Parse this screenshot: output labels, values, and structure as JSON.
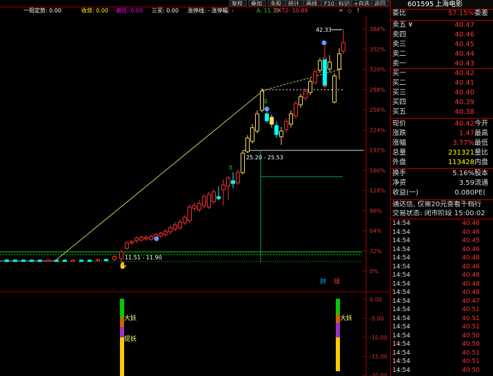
{
  "toolbar": {
    "buttons": [
      "复权",
      "叠加",
      "多股",
      "统计",
      "画线",
      "F10",
      "标记",
      "+自选",
      "返回"
    ]
  },
  "legend": {
    "items": [
      {
        "text": "一阳定势: 0.00",
        "color": "#ffffff"
      },
      {
        "text": "收敛: 0.00",
        "color": "#ffff00"
      },
      {
        "text": "偏低: 0.00",
        "color": "#ff00ff"
      },
      {
        "text": "三买: 0.00",
        "color": "#ffffff"
      },
      {
        "text": "涨停线: - 涨停幅: -",
        "color": "#ffffff"
      },
      {
        "text": "A: 11.39",
        "color": "#33cc33"
      },
      {
        "text": "EXT2: 10.89",
        "color": "#ff3366"
      }
    ],
    "icons": [
      "cross-icon",
      "diamond-icon",
      "arrow-up-icon"
    ]
  },
  "stock": {
    "code": "601595",
    "name": "上海电影"
  },
  "quote_rows": [
    {
      "label": "委比",
      "value": "57.15%",
      "extra": "委差"
    },
    {
      "label": "卖五 ¥",
      "value": "40.47",
      "extra": ""
    },
    {
      "label": "卖四",
      "value": "40.46",
      "extra": ""
    },
    {
      "label": "卖三",
      "value": "40.45",
      "extra": ""
    },
    {
      "label": "卖二",
      "value": "40.44",
      "extra": ""
    },
    {
      "label": "卖一",
      "value": "40.43",
      "extra": ""
    },
    {
      "label": "买一",
      "value": "40.42",
      "extra": ""
    },
    {
      "label": "买二",
      "value": "40.41",
      "extra": ""
    },
    {
      "label": "买三",
      "value": "40.40",
      "extra": ""
    },
    {
      "label": "买四",
      "value": "40.39",
      "extra": ""
    },
    {
      "label": "买五",
      "value": "40.38",
      "extra": ""
    },
    {
      "label": "现价",
      "value": "40.42",
      "extra": "今开"
    },
    {
      "label": "涨跌",
      "value": "1.47",
      "extra": "最高"
    },
    {
      "label": "涨幅",
      "value": "3.77%",
      "extra": "最低"
    },
    {
      "label": "总量",
      "value": "231321",
      "extra": "量比"
    },
    {
      "label": "外盘",
      "value": "113428",
      "extra": "内盘"
    },
    {
      "label": "换手",
      "value": "5.16%",
      "extra": "股本"
    },
    {
      "label": "净资",
      "value": "3.59",
      "extra": "流通"
    },
    {
      "label": "收益(一)",
      "value": "0.080",
      "extra": "PE("
    }
  ],
  "notice": "通达信, 仅需20元查看千档行",
  "trade_status": "交易状态: 闭市阶段 15:00:02",
  "trades": [
    {
      "time": "14:54",
      "price": "40.46"
    },
    {
      "time": "14:54",
      "price": "40.46"
    },
    {
      "time": "14:54",
      "price": "40.45"
    },
    {
      "time": "14:54",
      "price": "40.46"
    },
    {
      "time": "14:54",
      "price": "40.48"
    },
    {
      "time": "14:54",
      "price": "40.46"
    },
    {
      "time": "14:54",
      "price": "40.48"
    },
    {
      "time": "14:54",
      "price": "40.48"
    },
    {
      "time": "14:54",
      "price": "40.48"
    },
    {
      "time": "14:54",
      "price": "40.47"
    },
    {
      "time": "14:54",
      "price": "40.51"
    },
    {
      "time": "14:54",
      "price": "40.51"
    },
    {
      "time": "14:54",
      "price": "40.51"
    },
    {
      "time": "14:54",
      "price": "40.50"
    },
    {
      "time": "14:54",
      "price": "40.50"
    },
    {
      "time": "14:54",
      "price": "40.51"
    },
    {
      "time": "14:54",
      "price": "40.51"
    },
    {
      "time": "14:54",
      "price": "40.50"
    }
  ],
  "price_axis": [
    "384%",
    "352%",
    "320%",
    "288%",
    "256%",
    "224%",
    "192%",
    "160%",
    "128%",
    "96%",
    "64%",
    "32%",
    "0%"
  ],
  "indicator_axis": [
    "0.00",
    "-5.00",
    "-10.00",
    "-15.00",
    "-20.00"
  ],
  "annotations": {
    "high": "42.33",
    "range_high": "25.20 - 25.53",
    "range_low": "11.51 - 11.90",
    "cai": "财",
    "lu": "禄",
    "indicator_a": "大妖",
    "indicator_b": "提妖",
    "indicator_c": "大妖"
  },
  "chart_data": {
    "type": "candlestick",
    "y_axis_ticks": [
      "384%",
      "352%",
      "320%",
      "288%",
      "256%",
      "224%",
      "192%",
      "160%",
      "128%",
      "96%",
      "64%",
      "32%",
      "0%"
    ],
    "y_axis_values": [
      384,
      352,
      320,
      288,
      256,
      224,
      192,
      160,
      128,
      96,
      64,
      32,
      0
    ],
    "indicator_ticks": [
      "0.00",
      "-5.00",
      "-10.00",
      "-15.00",
      "-20.00"
    ],
    "indicator_values": [
      0,
      -5,
      -10,
      -15,
      -20
    ],
    "marked_high": "42.33",
    "ranges": [
      "25.20 - 25.53",
      "11.51 - 11.90"
    ]
  }
}
